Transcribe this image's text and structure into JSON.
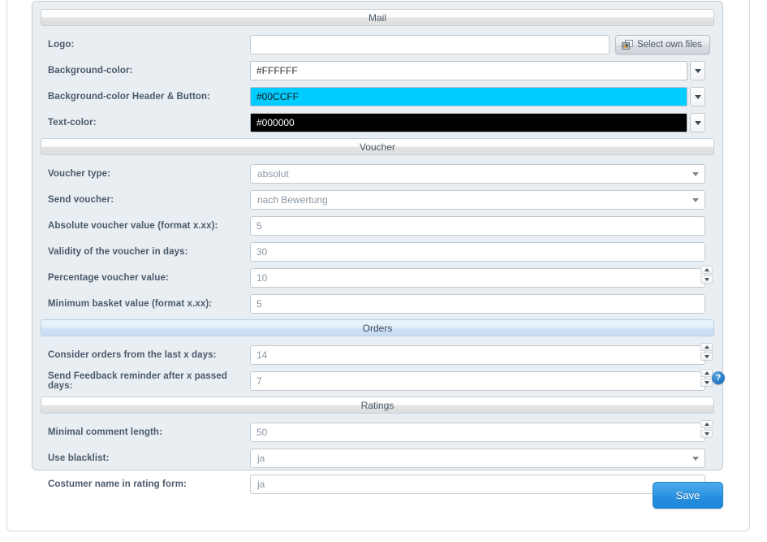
{
  "sections": {
    "mail": {
      "title": "Mail",
      "active": false,
      "rows": {
        "logo": {
          "label": "Logo:",
          "value": "",
          "button_label": "Select own files",
          "icon": "image-picker-icon"
        },
        "background_color": {
          "label": "Background-color:",
          "value": "#FFFFFF",
          "swatch": "#FFFFFF",
          "text_color": "#333333"
        },
        "background_color_header_button": {
          "label": "Background-color Header & Button:",
          "value": "#00CCFF",
          "swatch": "#00CCFF",
          "text_color": "#1a1a1a"
        },
        "text_color": {
          "label": "Text-color:",
          "value": "#000000",
          "swatch": "#000000",
          "text_color": "#FFFFFF"
        }
      }
    },
    "voucher": {
      "title": "Voucher",
      "active": false,
      "rows": {
        "voucher_type": {
          "label": "Voucher type:",
          "value": "absolut"
        },
        "send_voucher": {
          "label": "Send voucher:",
          "value": "nach Bewertung"
        },
        "absolute_value": {
          "label": "Absolute voucher value (format x.xx):",
          "value": "5"
        },
        "validity_days": {
          "label": "Validity of the voucher in days:",
          "value": "30"
        },
        "percentage_value": {
          "label": "Percentage voucher value:",
          "value": "10"
        },
        "minimum_basket": {
          "label": "Minimum basket value (format x.xx):",
          "value": "5"
        }
      }
    },
    "orders": {
      "title": "Orders",
      "active": true,
      "rows": {
        "consider_orders": {
          "label": "Consider orders from the last x days:",
          "value": "14"
        },
        "feedback_reminder": {
          "label": "Send Feedback reminder after x passed days:",
          "value": "7",
          "help_icon": "?"
        }
      }
    },
    "ratings": {
      "title": "Ratings",
      "active": false,
      "rows": {
        "minimal_comment_length": {
          "label": "Minimal comment length:",
          "value": "50"
        },
        "use_blacklist": {
          "label": "Use blacklist:",
          "value": "ja"
        },
        "customer_name": {
          "label": "Costumer name in rating form:",
          "value": "ja"
        }
      }
    }
  },
  "footer": {
    "save_label": "Save"
  },
  "colors": {
    "accent": "#2f97e3",
    "panel_bg": "#e9eef2",
    "active_bar": "#cfe2f4"
  }
}
